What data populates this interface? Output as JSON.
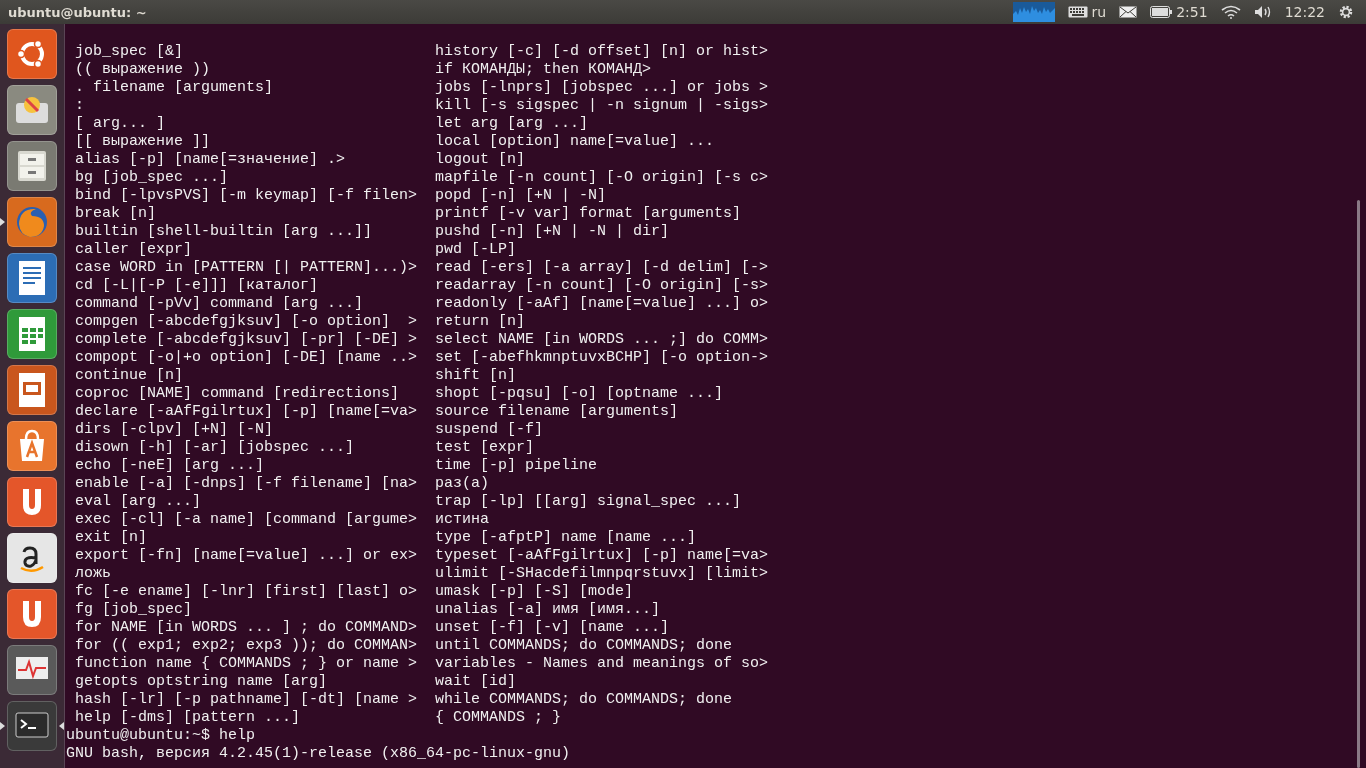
{
  "window": {
    "title": "ubuntu@ubuntu: ~"
  },
  "indicators": {
    "keyboard_layout": "ru",
    "battery_time": "2:51",
    "clock": "12:22"
  },
  "launcher": [
    {
      "kind": "ubuntu",
      "running": false,
      "focused": false
    },
    {
      "kind": "installer",
      "running": false,
      "focused": false
    },
    {
      "kind": "files",
      "running": false,
      "focused": false
    },
    {
      "kind": "firefox",
      "running": true,
      "focused": false
    },
    {
      "kind": "writer",
      "running": false,
      "focused": false
    },
    {
      "kind": "calc",
      "running": false,
      "focused": false
    },
    {
      "kind": "impress",
      "running": false,
      "focused": false
    },
    {
      "kind": "software",
      "running": false,
      "focused": false
    },
    {
      "kind": "ubuntuone",
      "running": false,
      "focused": false
    },
    {
      "kind": "amazon",
      "running": false,
      "focused": false
    },
    {
      "kind": "music",
      "running": false,
      "focused": false
    },
    {
      "kind": "monitor",
      "running": false,
      "focused": false
    },
    {
      "kind": "terminal",
      "running": true,
      "focused": true
    }
  ],
  "terminal": {
    "rows": [
      {
        "left": "job_spec [&]",
        "right": "history [-c] [-d offset] [n] or hist>"
      },
      {
        "left": "(( выражение ))",
        "right": "if КОМАНДЫ; then КОМАНД>"
      },
      {
        "left": ". filename [arguments]",
        "right": "jobs [-lnprs] [jobspec ...] or jobs >"
      },
      {
        "left": ":",
        "right": "kill [-s sigspec | -n signum | -sigs>"
      },
      {
        "left": "[ arg... ]",
        "right": "let arg [arg ...]"
      },
      {
        "left": "[[ выражение ]]",
        "right": "local [option] name[=value] ..."
      },
      {
        "left": "alias [-p] [name[=значение] .>",
        "right": "logout [n]"
      },
      {
        "left": "bg [job_spec ...]",
        "right": "mapfile [-n count] [-O origin] [-s c>"
      },
      {
        "left": "bind [-lpvsPVS] [-m keymap] [-f filen>",
        "right": "popd [-n] [+N | -N]"
      },
      {
        "left": "break [n]",
        "right": "printf [-v var] format [arguments]"
      },
      {
        "left": "builtin [shell-builtin [arg ...]]",
        "right": "pushd [-n] [+N | -N | dir]"
      },
      {
        "left": "caller [expr]",
        "right": "pwd [-LP]"
      },
      {
        "left": "case WORD in [PATTERN [| PATTERN]...)>",
        "right": "read [-ers] [-a array] [-d delim] [->"
      },
      {
        "left": "cd [-L|[-P [-e]]] [каталог]",
        "right": "readarray [-n count] [-O origin] [-s>"
      },
      {
        "left": "command [-pVv] command [arg ...]",
        "right": "readonly [-aAf] [name[=value] ...] o>"
      },
      {
        "left": "compgen [-abcdefgjksuv] [-o option]  >",
        "right": "return [n]"
      },
      {
        "left": "complete [-abcdefgjksuv] [-pr] [-DE] >",
        "right": "select NAME [in WORDS ... ;] do COMM>"
      },
      {
        "left": "compopt [-o|+o option] [-DE] [name ..>",
        "right": "set [-abefhkmnptuvxBCHP] [-o option->"
      },
      {
        "left": "continue [n]",
        "right": "shift [n]"
      },
      {
        "left": "coproc [NAME] command [redirections]",
        "right": "shopt [-pqsu] [-o] [optname ...]"
      },
      {
        "left": "declare [-aAfFgilrtux] [-p] [name[=va>",
        "right": "source filename [arguments]"
      },
      {
        "left": "dirs [-clpv] [+N] [-N]",
        "right": "suspend [-f]"
      },
      {
        "left": "disown [-h] [-ar] [jobspec ...]",
        "right": "test [expr]"
      },
      {
        "left": "echo [-neE] [arg ...]",
        "right": "time [-p] pipeline"
      },
      {
        "left": "enable [-a] [-dnps] [-f filename] [na>",
        "right": "раз(а)"
      },
      {
        "left": "eval [arg ...]",
        "right": "trap [-lp] [[arg] signal_spec ...]"
      },
      {
        "left": "exec [-cl] [-a name] [command [argume>",
        "right": "истина"
      },
      {
        "left": "exit [n]",
        "right": "type [-afptP] name [name ...]"
      },
      {
        "left": "export [-fn] [name[=value] ...] or ex>",
        "right": "typeset [-aAfFgilrtux] [-p] name[=va>"
      },
      {
        "left": "ложь",
        "right": "ulimit [-SHacdefilmnpqrstuvx] [limit>"
      },
      {
        "left": "fc [-e ename] [-lnr] [first] [last] o>",
        "right": "umask [-p] [-S] [mode]"
      },
      {
        "left": "fg [job_spec]",
        "right": "unalias [-a] имя [имя...]"
      },
      {
        "left": "for NAME [in WORDS ... ] ; do COMMAND>",
        "right": "unset [-f] [-v] [name ...]"
      },
      {
        "left": "for (( exp1; exp2; exp3 )); do COMMAN>",
        "right": "until COMMANDS; do COMMANDS; done"
      },
      {
        "left": "function name { COMMANDS ; } or name >",
        "right": "variables - Names and meanings of so>"
      },
      {
        "left": "getopts optstring name [arg]",
        "right": "wait [id]"
      },
      {
        "left": "hash [-lr] [-p pathname] [-dt] [name >",
        "right": "while COMMANDS; do COMMANDS; done"
      },
      {
        "left": "help [-dms] [pattern ...]",
        "right": "{ COMMANDS ; }"
      }
    ],
    "lines": [
      "ubuntu@ubuntu:~$ help",
      "GNU bash, версия 4.2.45(1)-release (x86_64-pc-linux-gnu)"
    ]
  }
}
